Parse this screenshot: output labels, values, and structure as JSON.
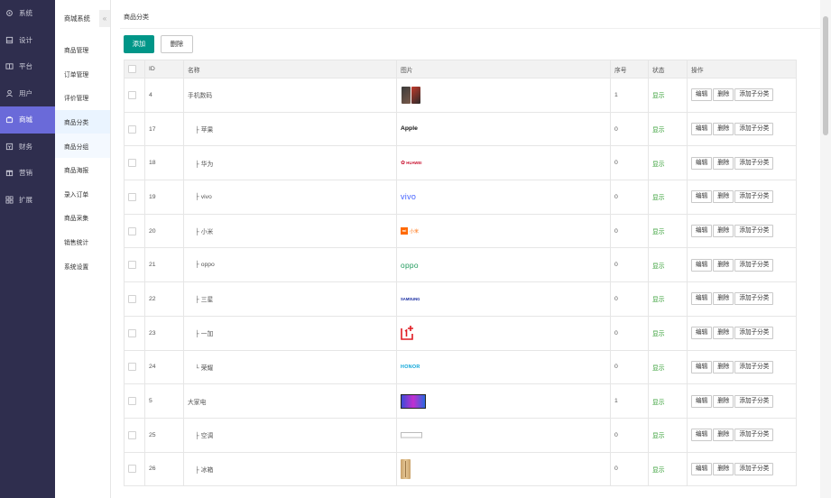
{
  "sidebar": {
    "items": [
      {
        "label": "系统",
        "icon": "gear-icon"
      },
      {
        "label": "设计",
        "icon": "design-icon"
      },
      {
        "label": "平台",
        "icon": "platform-icon"
      },
      {
        "label": "用户",
        "icon": "user-icon"
      },
      {
        "label": "商城",
        "icon": "shop-icon"
      },
      {
        "label": "财务",
        "icon": "finance-icon"
      },
      {
        "label": "营销",
        "icon": "marketing-icon"
      },
      {
        "label": "扩展",
        "icon": "extension-icon"
      }
    ],
    "active_index": 4
  },
  "subnav": {
    "title": "商城系统",
    "collapse_glyph": "«",
    "items": [
      "商品管理",
      "订单管理",
      "评价管理",
      "商品分类",
      "商品分组",
      "商品海报",
      "录入订单",
      "商品采集",
      "销售统计",
      "系统设置"
    ]
  },
  "breadcrumb": "商品分类",
  "toolbar": {
    "add_label": "添加",
    "delete_label": "删除"
  },
  "table": {
    "headers": {
      "id": "ID",
      "name": "名称",
      "image": "图片",
      "order": "序号",
      "status": "状态",
      "actions": "操作"
    },
    "actions": {
      "edit": "编辑",
      "delete": "删除",
      "add_child": "添加子分类"
    },
    "rows": [
      {
        "id": "4",
        "name": "手机数码",
        "logo": "phone",
        "order": "1",
        "status": "显示"
      },
      {
        "id": "17",
        "name": "├ 苹果",
        "logo": "apple",
        "logo_text": "Apple",
        "order": "0",
        "status": "显示"
      },
      {
        "id": "18",
        "name": "├ 华为",
        "logo": "huawei",
        "logo_text": "HUAWEI",
        "order": "0",
        "status": "显示"
      },
      {
        "id": "19",
        "name": "├ vivo",
        "logo": "vivo",
        "logo_text": "vivo",
        "order": "0",
        "status": "显示"
      },
      {
        "id": "20",
        "name": "├ 小米",
        "logo": "xiaomi",
        "logo_text": "小米",
        "order": "0",
        "status": "显示"
      },
      {
        "id": "21",
        "name": "├ oppo",
        "logo": "oppo",
        "logo_text": "oppo",
        "order": "0",
        "status": "显示"
      },
      {
        "id": "22",
        "name": "├ 三星",
        "logo": "samsung",
        "logo_text": "SAMSUNG",
        "order": "0",
        "status": "显示"
      },
      {
        "id": "23",
        "name": "├ 一加",
        "logo": "oneplus",
        "order": "0",
        "status": "显示"
      },
      {
        "id": "24",
        "name": "└ 荣耀",
        "logo": "honor",
        "logo_text": "HONOR",
        "order": "0",
        "status": "显示"
      },
      {
        "id": "5",
        "name": "大家电",
        "logo": "tv",
        "order": "1",
        "status": "显示"
      },
      {
        "id": "25",
        "name": "├ 空调",
        "logo": "ac",
        "order": "0",
        "status": "显示"
      },
      {
        "id": "26",
        "name": "├ 冰箱",
        "logo": "fridge",
        "order": "0",
        "status": "显示"
      }
    ]
  },
  "colors": {
    "sidebar_bg": "#2f2e4e",
    "sidebar_active": "#6a6ad9",
    "primary_button": "#009688",
    "status_green": "#2e9b2e"
  }
}
